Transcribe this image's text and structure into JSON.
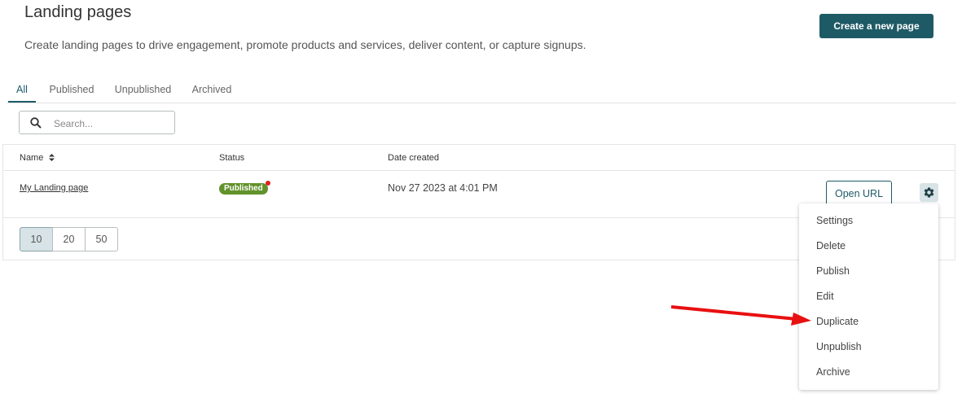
{
  "header": {
    "title": "Landing pages",
    "subtitle": "Create landing pages to drive engagement, promote products and services, deliver content, or capture signups.",
    "create_button": "Create a new page"
  },
  "tabs": [
    {
      "label": "All",
      "active": true
    },
    {
      "label": "Published",
      "active": false
    },
    {
      "label": "Unpublished",
      "active": false
    },
    {
      "label": "Archived",
      "active": false
    }
  ],
  "search": {
    "placeholder": "Search...",
    "value": ""
  },
  "table": {
    "columns": [
      "Name",
      "Status",
      "Date created"
    ],
    "rows": [
      {
        "name": "My Landing page",
        "status": "Published",
        "date_created": "Nov 27 2023 at 4:01 PM",
        "action_button": "Open URL"
      }
    ]
  },
  "pagination": {
    "options": [
      "10",
      "20",
      "50"
    ],
    "selected": "10"
  },
  "actions_menu": {
    "items": [
      "Settings",
      "Delete",
      "Publish",
      "Edit",
      "Duplicate",
      "Unpublish",
      "Archive"
    ]
  },
  "colors": {
    "primary": "#1e5a66",
    "published_badge": "#62922b",
    "annotation_arrow": "#e81010"
  },
  "icons": [
    "search-icon",
    "sort-icon",
    "gear-icon",
    "notification-dot"
  ]
}
